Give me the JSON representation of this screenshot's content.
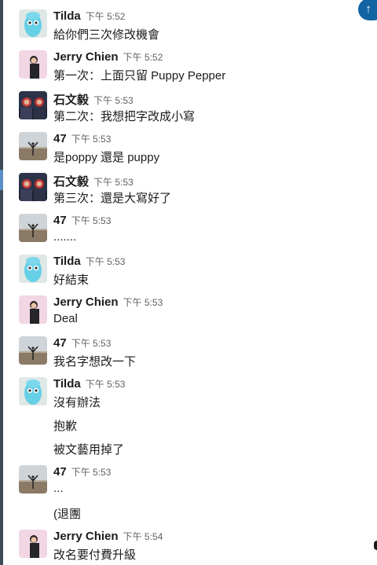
{
  "jump_icon": "arrow-up-icon",
  "messages": [
    {
      "sender": "Tilda",
      "avatar": "tilda",
      "time": "下午 5:52",
      "lines": [
        "給你們三次修改機會"
      ]
    },
    {
      "sender": "Jerry Chien",
      "avatar": "jerry",
      "time": "下午 5:52",
      "lines": [
        "第一次：上面只留 Puppy Pepper"
      ]
    },
    {
      "sender": "石文毅",
      "avatar": "shi",
      "time": "下午 5:53",
      "lines": [
        "第二次：我想把字改成小寫"
      ]
    },
    {
      "sender": "47",
      "avatar": "47",
      "time": "下午 5:53",
      "lines": [
        "是poppy 還是 puppy"
      ]
    },
    {
      "sender": "石文毅",
      "avatar": "shi",
      "time": "下午 5:53",
      "lines": [
        "第三次：還是大寫好了"
      ]
    },
    {
      "sender": "47",
      "avatar": "47",
      "time": "下午 5:53",
      "lines": [
        "......."
      ]
    },
    {
      "sender": "Tilda",
      "avatar": "tilda",
      "time": "下午 5:53",
      "lines": [
        "好結束"
      ]
    },
    {
      "sender": "Jerry Chien",
      "avatar": "jerry",
      "time": "下午 5:53",
      "lines": [
        "Deal"
      ]
    },
    {
      "sender": "47",
      "avatar": "47",
      "time": "下午 5:53",
      "lines": [
        "我名字想改一下"
      ]
    },
    {
      "sender": "Tilda",
      "avatar": "tilda",
      "time": "下午 5:53",
      "lines": [
        "沒有辦法"
      ],
      "continuation": [
        "抱歉",
        "被文藝用掉了"
      ]
    },
    {
      "sender": "47",
      "avatar": "47",
      "time": "下午 5:53",
      "lines": [
        "..."
      ],
      "continuation": [
        "(退團"
      ]
    },
    {
      "sender": "Jerry Chien",
      "avatar": "jerry",
      "time": "下午 5:54",
      "lines": [
        "改名要付費升級"
      ]
    }
  ]
}
